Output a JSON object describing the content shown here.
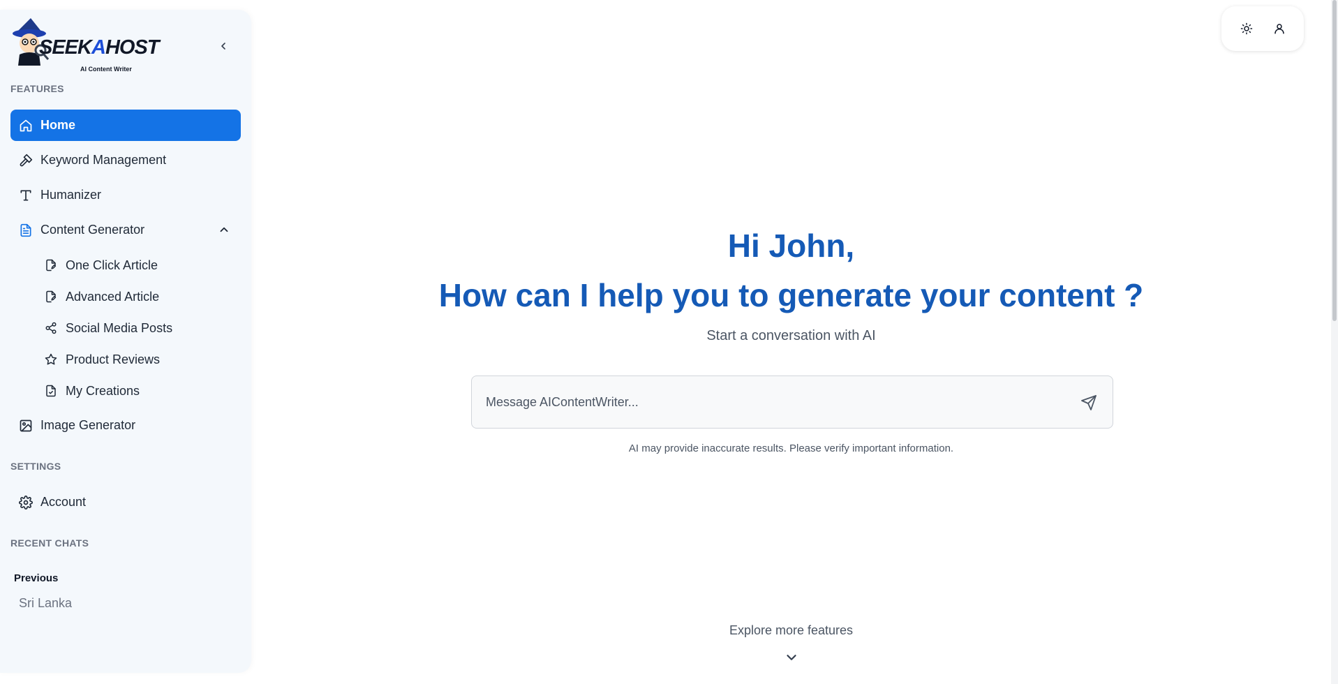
{
  "brand": {
    "name_part1": "SEEK",
    "name_part2": "A",
    "name_part3": "HOST",
    "subtitle": "AI Content Writer"
  },
  "sidebar": {
    "features_label": "FEATURES",
    "items": [
      {
        "label": "Home",
        "icon": "home-icon",
        "active": true
      },
      {
        "label": "Keyword Management",
        "icon": "hammer-icon"
      },
      {
        "label": "Humanizer",
        "icon": "text-t-icon"
      },
      {
        "label": "Content Generator",
        "icon": "document-icon",
        "expanded": true
      }
    ],
    "sub_items": [
      {
        "label": "One Click Article",
        "icon": "file-pen-icon"
      },
      {
        "label": "Advanced Article",
        "icon": "file-pen-icon"
      },
      {
        "label": "Social Media Posts",
        "icon": "share-icon"
      },
      {
        "label": "Product Reviews",
        "icon": "star-icon"
      },
      {
        "label": "My Creations",
        "icon": "file-check-icon"
      }
    ],
    "image_generator": {
      "label": "Image Generator",
      "icon": "image-icon"
    },
    "settings_label": "SETTINGS",
    "account": {
      "label": "Account",
      "icon": "gear-icon"
    },
    "recent_label": "RECENT CHATS",
    "recent_group": "Previous",
    "recent_chats": [
      "Sri Lanka"
    ]
  },
  "main": {
    "greeting_line1": "Hi John,",
    "greeting_line2": "How can I help you to generate your content ?",
    "subtitle": "Start a conversation with AI",
    "input_placeholder": "Message AIContentWriter...",
    "disclaimer": "AI may provide inaccurate results. Please verify important information.",
    "explore": "Explore more features"
  },
  "colors": {
    "accent": "#1473e6",
    "heading": "#155ab6",
    "sidebar_bg": "#f4f8fc"
  }
}
